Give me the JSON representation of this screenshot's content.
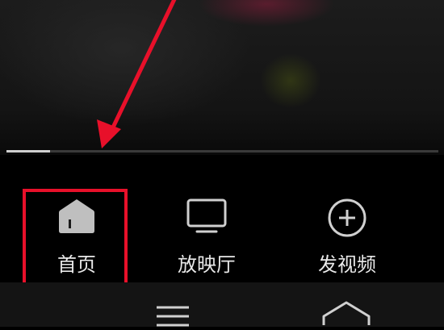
{
  "player": {
    "progress_percent": 10
  },
  "tabs": [
    {
      "label": "首页",
      "icon": "home-icon",
      "active": true
    },
    {
      "label": "放映厅",
      "icon": "tv-icon",
      "active": false
    },
    {
      "label": "发视频",
      "icon": "plus-circle-icon",
      "active": false
    }
  ],
  "annotation": {
    "color": "#e8102a"
  },
  "system_nav": {
    "icons": [
      "menu-icon",
      "home-outline-icon"
    ]
  }
}
